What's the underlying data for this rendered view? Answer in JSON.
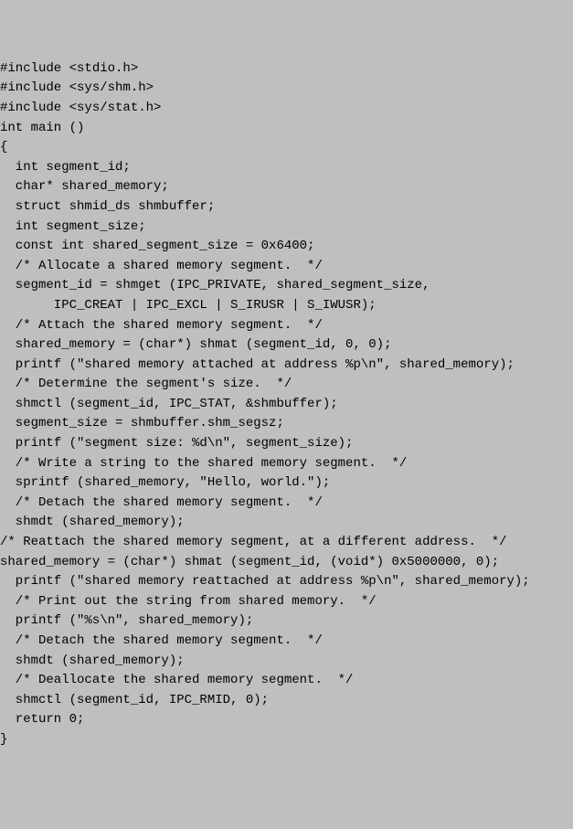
{
  "code_lines": [
    "#include <stdio.h>",
    "#include <sys/shm.h>",
    "#include <sys/stat.h>",
    "int main ()",
    "{",
    "  int segment_id;",
    "  char* shared_memory;",
    "  struct shmid_ds shmbuffer;",
    "  int segment_size;",
    "  const int shared_segment_size = 0x6400;",
    "  /* Allocate a shared memory segment.  */",
    "  segment_id = shmget (IPC_PRIVATE, shared_segment_size,",
    "       IPC_CREAT | IPC_EXCL | S_IRUSR | S_IWUSR);",
    "  /* Attach the shared memory segment.  */",
    "  shared_memory = (char*) shmat (segment_id, 0, 0);",
    "  printf (\"shared memory attached at address %p\\n\", shared_memory);",
    "  /* Determine the segment's size.  */",
    "  shmctl (segment_id, IPC_STAT, &shmbuffer);",
    "  segment_size = shmbuffer.shm_segsz;",
    "  printf (\"segment size: %d\\n\", segment_size);",
    "  /* Write a string to the shared memory segment.  */",
    "  sprintf (shared_memory, \"Hello, world.\");",
    "  /* Detach the shared memory segment.  */",
    "  shmdt (shared_memory);",
    "/* Reattach the shared memory segment, at a different address.  */",
    "shared_memory = (char*) shmat (segment_id, (void*) 0x5000000, 0);",
    "  printf (\"shared memory reattached at address %p\\n\", shared_memory);",
    "  /* Print out the string from shared memory.  */",
    "  printf (\"%s\\n\", shared_memory);",
    "  /* Detach the shared memory segment.  */",
    "  shmdt (shared_memory);",
    "  /* Deallocate the shared memory segment.  */",
    "  shmctl (segment_id, IPC_RMID, 0);",
    "  return 0;",
    "}"
  ]
}
